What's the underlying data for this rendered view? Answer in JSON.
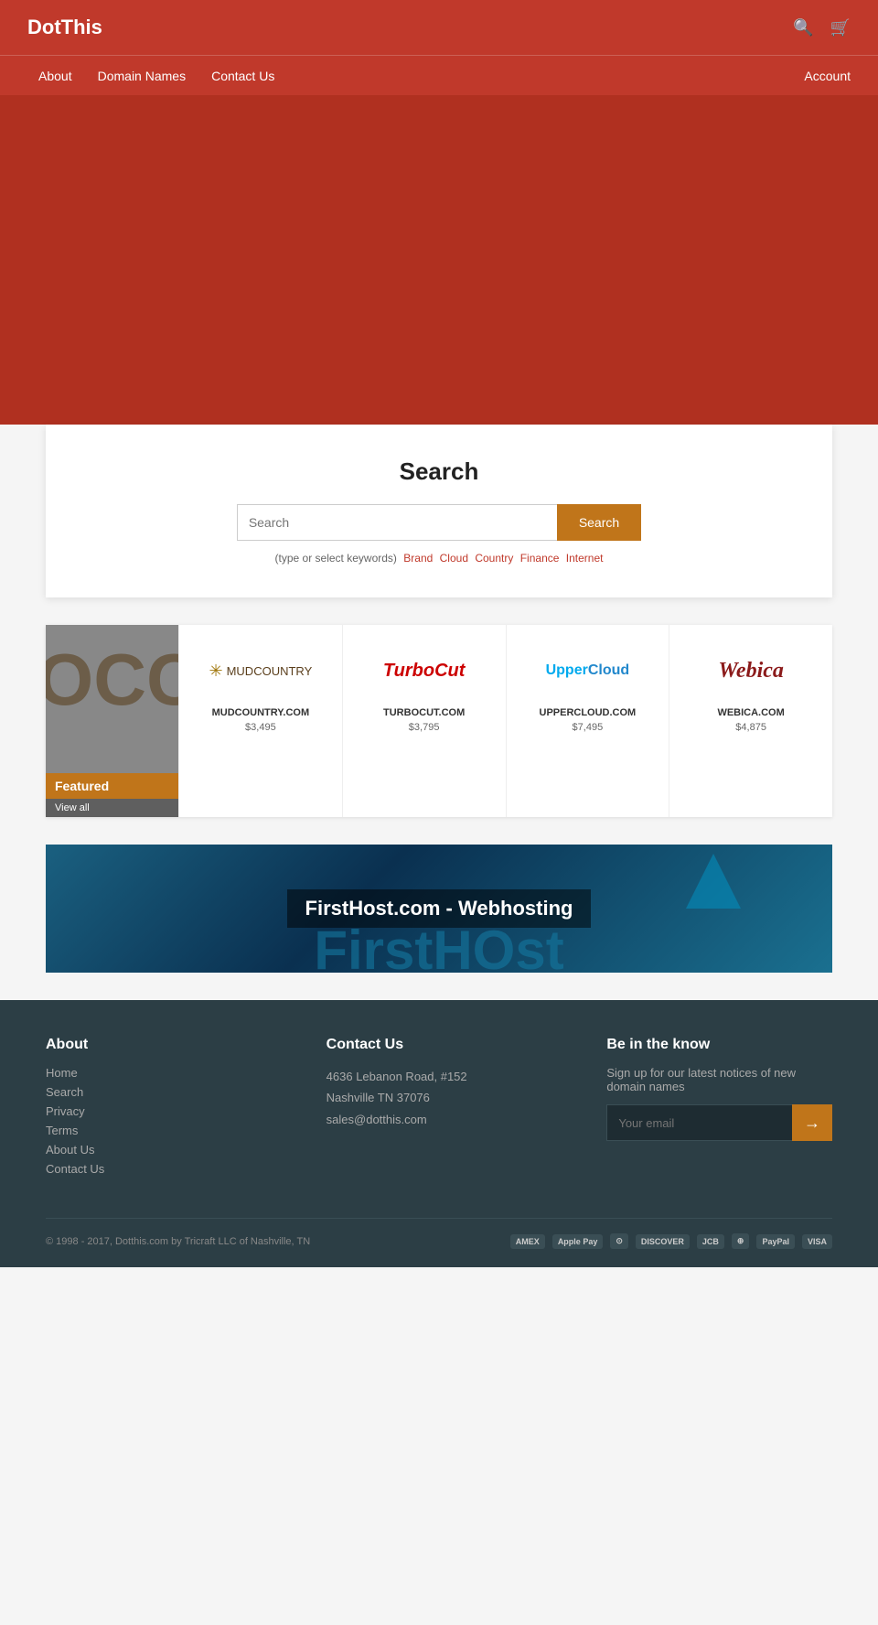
{
  "header": {
    "title": "DotThis",
    "icons": {
      "search": "🔍",
      "cart": "🛒"
    }
  },
  "nav": {
    "items": [
      {
        "label": "About",
        "has_dropdown": true
      },
      {
        "label": "Domain Names",
        "has_dropdown": false
      },
      {
        "label": "Contact Us",
        "has_dropdown": false
      }
    ],
    "account_label": "Account"
  },
  "search": {
    "title": "Search",
    "placeholder": "Search",
    "button_label": "Search",
    "keywords_prefix": "(type or select keywords)",
    "keywords": [
      "Brand",
      "Cloud",
      "Country",
      "Finance",
      "Internet"
    ]
  },
  "featured": {
    "label": "Featured",
    "view_all": "View all",
    "products": [
      {
        "name": "MUDCOUNTRY.COM",
        "price": "$3,495",
        "logo_type": "mudcountry"
      },
      {
        "name": "TURBOCUT.COM",
        "price": "$3,795",
        "logo_type": "turbocut"
      },
      {
        "name": "UPPERCLOUD.COM",
        "price": "$7,495",
        "logo_type": "uppercloud"
      },
      {
        "name": "WEBICA.COM",
        "price": "$4,875",
        "logo_type": "webica"
      }
    ]
  },
  "banner": {
    "text": "FirstHost.com - Webhosting",
    "large_text": "FirstHOst"
  },
  "footer": {
    "about_heading": "About",
    "about_links": [
      "Home",
      "Search",
      "Privacy",
      "Terms",
      "About Us",
      "Contact Us"
    ],
    "contact_heading": "Contact Us",
    "address_line1": "4636 Lebanon Road, #152",
    "address_line2": "Nashville TN 37076",
    "address_email": "sales@dotthis.com",
    "newsletter_heading": "Be in the know",
    "newsletter_text": "Sign up for our latest notices of new domain names",
    "newsletter_placeholder": "Your email",
    "newsletter_button": "→",
    "copyright": "© 1998 - 2017, Dotthis.com by Tricraft LLC of Nashville, TN",
    "payment_methods": [
      "AMEX",
      "Apple Pay",
      "Diners",
      "DISCOVER",
      "JCB",
      "Mastercard",
      "PayPal",
      "VISA"
    ]
  }
}
